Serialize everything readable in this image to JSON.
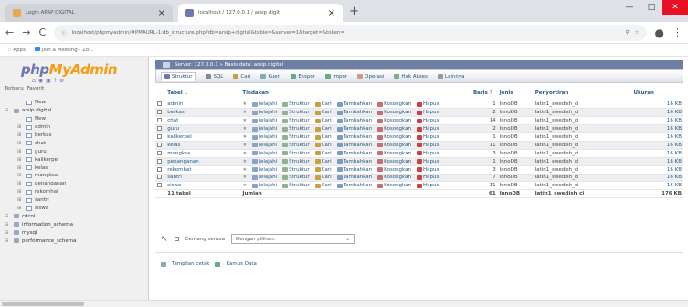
{
  "browser": {
    "tabs": [
      {
        "title": "Login APAP DIGITAL",
        "active": false
      },
      {
        "title": "localhost / 127.0.0.1 / arsip digit",
        "active": true
      }
    ],
    "url": "localhost/phpmyadmin/#PMAURL-1:db_structure.php?db=arsip+digital&table=&server=1&target=&token=",
    "bookmarks": [
      "Apps",
      "Join a Meeting - Zo..."
    ]
  },
  "sidebar": {
    "logo_php": "php",
    "logo_myadmin": "MyAdmin",
    "recent": "Terbaru",
    "favorite": "Favorit",
    "tree": [
      {
        "label": "New",
        "type": "new",
        "indent": 1
      },
      {
        "label": "arsip digital",
        "type": "db",
        "indent": 0
      },
      {
        "label": "New",
        "type": "new",
        "indent": 1
      },
      {
        "label": "admin",
        "type": "table",
        "indent": 1
      },
      {
        "label": "berkas",
        "type": "table",
        "indent": 1
      },
      {
        "label": "chat",
        "type": "table",
        "indent": 1
      },
      {
        "label": "guru",
        "type": "table",
        "indent": 1
      },
      {
        "label": "kalikerpel",
        "type": "table",
        "indent": 1
      },
      {
        "label": "kelas",
        "type": "table",
        "indent": 1
      },
      {
        "label": "mangksa",
        "type": "table",
        "indent": 1
      },
      {
        "label": "penanganan",
        "type": "table",
        "indent": 1
      },
      {
        "label": "rekomhat",
        "type": "table",
        "indent": 1
      },
      {
        "label": "santri",
        "type": "table",
        "indent": 1
      },
      {
        "label": "siswa",
        "type": "table",
        "indent": 1
      },
      {
        "label": "cdcol",
        "type": "db",
        "indent": 0
      },
      {
        "label": "information_schema",
        "type": "db",
        "indent": 0
      },
      {
        "label": "mysql",
        "type": "db",
        "indent": 0
      },
      {
        "label": "performance_schema",
        "type": "db",
        "indent": 0
      }
    ]
  },
  "main": {
    "breadcrumb": "Server: 127.0.0.1 » Basis data: arsip digital",
    "tabs": [
      "Struktur",
      "SQL",
      "Cari",
      "Kueri",
      "Ekspor",
      "Impor",
      "Operasi",
      "Hak Akses",
      "Lainnya"
    ],
    "columns": [
      "Tabel",
      "Tindakan",
      "Baris",
      "Jenis",
      "Penyortiran",
      "Ukuran"
    ],
    "actions": [
      "Jelajahi",
      "Struktur",
      "Cari",
      "Tambahkan",
      "Kosongkan",
      "Hapus"
    ],
    "rows": [
      {
        "name": "admin",
        "rows": "1",
        "type": "InnoDB",
        "collation": "latin1_swedish_ci",
        "size": "16 KB"
      },
      {
        "name": "berkas",
        "rows": "2",
        "type": "InnoDB",
        "collation": "latin1_swedish_ci",
        "size": "16 KB"
      },
      {
        "name": "chat",
        "rows": "14",
        "type": "InnoDB",
        "collation": "latin1_swedish_ci",
        "size": "16 KB"
      },
      {
        "name": "guru",
        "rows": "2",
        "type": "InnoDB",
        "collation": "latin1_swedish_ci",
        "size": "16 KB"
      },
      {
        "name": "kalikerpel",
        "rows": "1",
        "type": "InnoDB",
        "collation": "latin1_swedish_ci",
        "size": "16 KB"
      },
      {
        "name": "kelas",
        "rows": "11",
        "type": "InnoDB",
        "collation": "latin1_swedish_ci",
        "size": "16 KB"
      },
      {
        "name": "mangksa",
        "rows": "3",
        "type": "InnoDB",
        "collation": "latin1_swedish_ci",
        "size": "16 KB"
      },
      {
        "name": "penanganan",
        "rows": "1",
        "type": "InnoDB",
        "collation": "latin1_swedish_ci",
        "size": "16 KB"
      },
      {
        "name": "rekomhat",
        "rows": "3",
        "type": "InnoDB",
        "collation": "latin1_swedish_ci",
        "size": "16 KB"
      },
      {
        "name": "santri",
        "rows": "7",
        "type": "InnoDB",
        "collation": "latin1_swedish_ci",
        "size": "16 KB"
      },
      {
        "name": "siswa",
        "rows": "11",
        "type": "InnoDB",
        "collation": "latin1_swedish_ci",
        "size": "16 KB"
      }
    ],
    "total": {
      "label": "11 tabel",
      "sum": "Jumlah",
      "rows": "61",
      "type": "InnoDB",
      "collation": "latin1_swedish_ci",
      "size": "176 KB"
    },
    "check_all": "Centang semua",
    "with_selected": "Dengan pilihan:",
    "print_view": "Tampilan cetak",
    "data_dictionary": "Kamus Data"
  },
  "colors": {
    "php_blue": "#6c78af",
    "myadmin_orange": "#f89c0e",
    "link_blue": "#235a81"
  }
}
